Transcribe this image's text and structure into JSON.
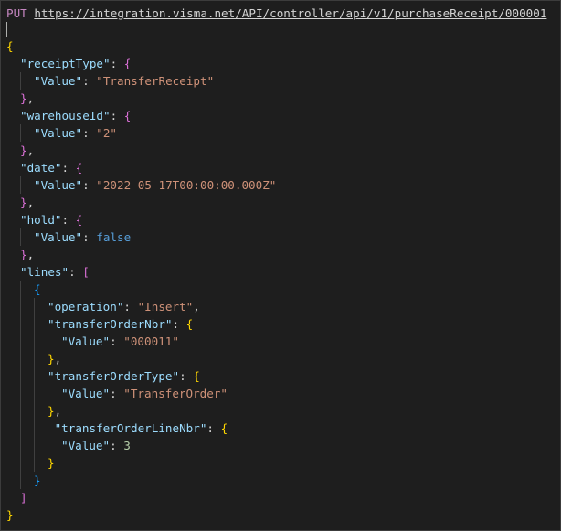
{
  "request": {
    "method": "PUT",
    "url": "https://integration.visma.net/API/controller/api/v1/purchaseReceipt/000001"
  },
  "json": {
    "k_receiptType": "\"receiptType\"",
    "k_value": "\"Value\"",
    "v_receiptType": "\"TransferReceipt\"",
    "k_warehouseId": "\"warehouseId\"",
    "v_warehouseId": "\"2\"",
    "k_date": "\"date\"",
    "v_date": "\"2022-05-17T00:00:00.000Z\"",
    "k_hold": "\"hold\"",
    "v_hold": "false",
    "k_lines": "\"lines\"",
    "k_operation": "\"operation\"",
    "v_operation": "\"Insert\"",
    "k_transferOrderNbr": "\"transferOrderNbr\"",
    "v_transferOrderNbr": "\"000011\"",
    "k_transferOrderType": "\"transferOrderType\"",
    "v_transferOrderType": "\"TransferOrder\"",
    "k_transferOrderLineNbr": "\"transferOrderLineNbr\"",
    "v_transferOrderLineNbr": "3"
  },
  "colors": {
    "background": "#1e1e1e",
    "key": "#9cdcfe",
    "string": "#ce9178",
    "number": "#b5cea8",
    "boolean": "#569cd6",
    "bracket_level1": "#ffd700",
    "bracket_level2": "#da70d6",
    "bracket_level3": "#179fff"
  }
}
